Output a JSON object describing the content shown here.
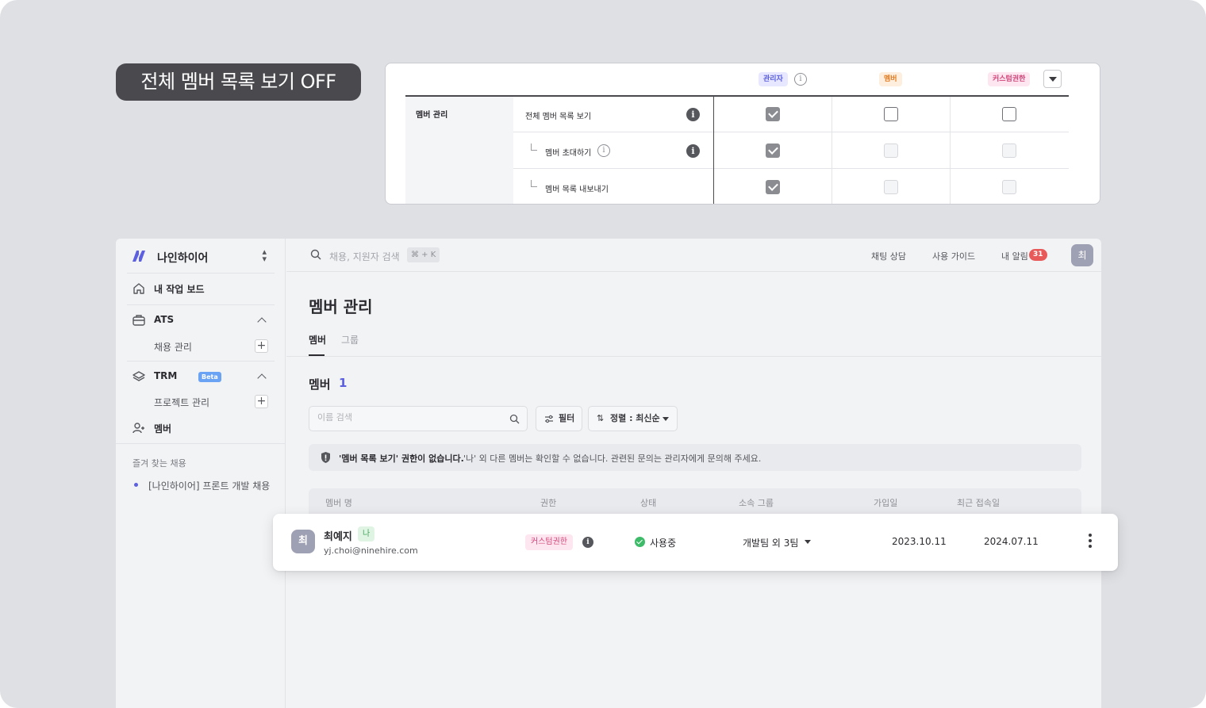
{
  "headline": "전체 멤버 목록 보기 OFF",
  "permissions": {
    "roles": [
      {
        "label": "관리자",
        "color": "#5b5fe0"
      },
      {
        "label": "멤버",
        "color": "#e37b20"
      },
      {
        "label": "커스텀권한",
        "color": "#d2457a"
      }
    ],
    "group_label": "멤버 관리",
    "rows": [
      {
        "label": "전체 멤버 목록 보기",
        "admin": "checked",
        "member": "unchecked",
        "custom": "unchecked"
      },
      {
        "label": "멤버 초대하기",
        "admin": "checked",
        "member": "disabled",
        "custom": "disabled"
      },
      {
        "label": "멤버 목록 내보내기",
        "admin": "checked",
        "member": "disabled",
        "custom": "disabled"
      }
    ]
  },
  "app": {
    "workspace": "나인하이어",
    "sidebar": {
      "dashboard": "내 작업 보드",
      "ats": "ATS",
      "ats_sub": "채용 관리",
      "trm": "TRM",
      "trm_badge": "Beta",
      "trm_sub": "프로젝트 관리",
      "members": "멤버",
      "favorites_title": "즐겨 찾는 채용",
      "favorite_item": "[나인하이어] 프론트 개발 채용"
    },
    "topbar": {
      "search_placeholder": "채용, 지원자 검색",
      "shortcut": "⌘ + K",
      "chat": "채팅 상담",
      "guide": "사용 가이드",
      "notifications": "내 알림",
      "notification_count": "31",
      "avatar": "최"
    },
    "page_title": "멤버 관리",
    "tabs": [
      "멤버",
      "그룹"
    ],
    "section_label": "멤버",
    "member_count": "1",
    "name_search_placeholder": "이름 검색",
    "filter_label": "필터",
    "sort_label": "정렬 : 최신순",
    "notice_strong": "'멤버 목록 보기' 권한이 없습니다.",
    "notice_text": "'나' 외 다른 멤버는 확인할 수 없습니다. 관련된 문의는 관리자에게 문의해 주세요.",
    "columns": [
      "멤버 명",
      "권한",
      "상태",
      "소속 그룹",
      "가입일",
      "최근 접속일"
    ],
    "member_row": {
      "avatar": "최",
      "name": "최예지",
      "me_badge": "나",
      "email": "yj.choi@ninehire.com",
      "role": "커스텀권한",
      "status": "사용중",
      "group": "개발팀 외 3팀",
      "joined": "2023.10.11",
      "last_access": "2024.07.11"
    }
  }
}
